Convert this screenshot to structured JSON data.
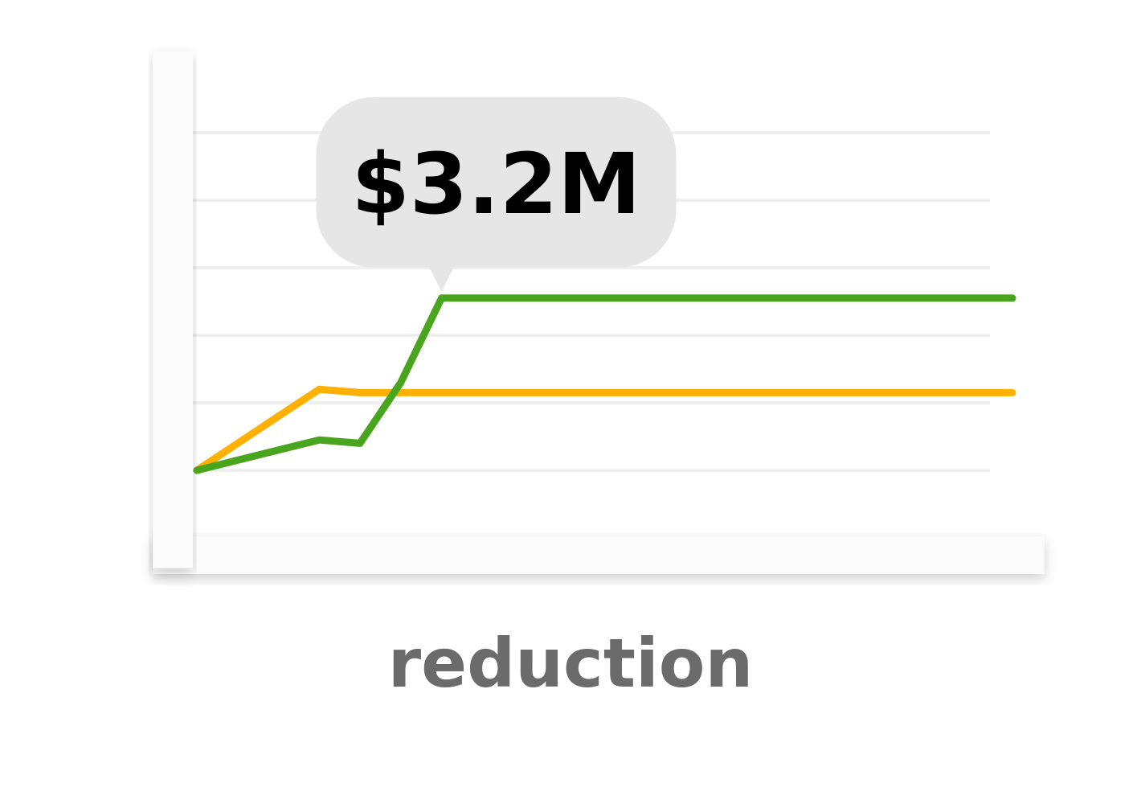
{
  "chart_data": {
    "type": "line",
    "title": "",
    "xlabel": "reduction",
    "ylabel": "",
    "ylim": [
      0,
      5
    ],
    "grid": true,
    "legend": "none",
    "x": [
      0,
      1,
      2,
      3,
      4,
      5,
      6,
      7,
      8,
      9,
      10,
      11,
      12,
      13,
      14,
      15,
      16,
      17,
      18,
      19,
      20
    ],
    "series": [
      {
        "color": "#FFB000",
        "values": [
          0,
          0.4,
          0.8,
          1.2,
          1.15,
          1.15,
          1.15,
          1.15,
          1.15,
          1.15,
          1.15,
          1.15,
          1.15,
          1.15,
          1.15,
          1.15,
          1.15,
          1.15,
          1.15,
          1.15,
          1.15
        ]
      },
      {
        "color": "#4AA51E",
        "values": [
          0,
          0.15,
          0.3,
          0.45,
          0.4,
          1.3,
          2.55,
          2.55,
          2.55,
          2.55,
          2.55,
          2.55,
          2.55,
          2.55,
          2.55,
          2.55,
          2.55,
          2.55,
          2.55,
          2.55,
          2.55
        ]
      }
    ],
    "annotation": {
      "text": "$3.2M",
      "series_index": 1,
      "x": 6
    }
  }
}
